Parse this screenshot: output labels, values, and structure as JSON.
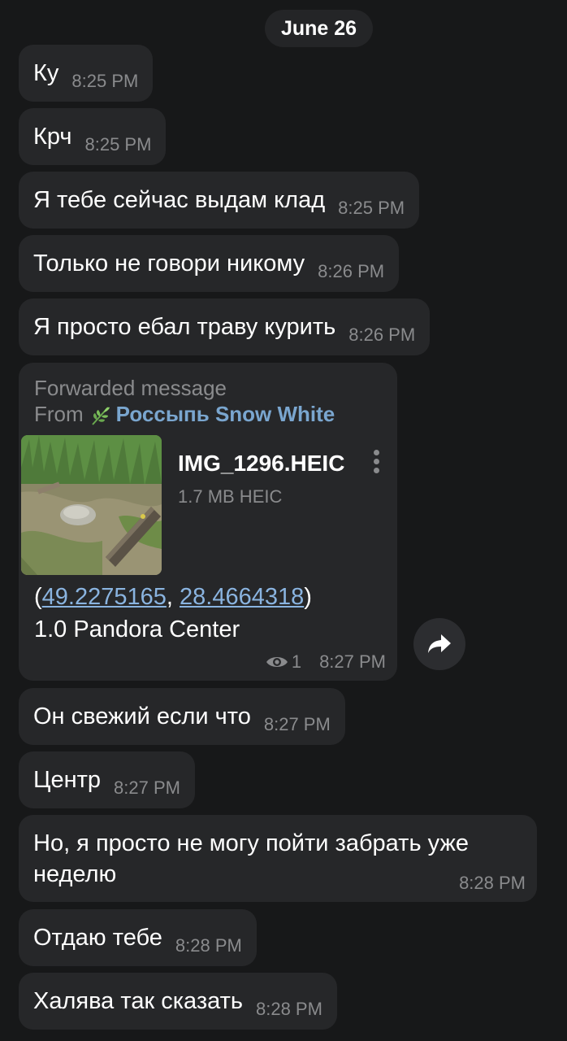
{
  "date_separator": "June 26",
  "messages_before": [
    {
      "text": "Ку",
      "time": "8:25 PM"
    },
    {
      "text": "Крч",
      "time": "8:25 PM"
    },
    {
      "text": "Я тебе сейчас выдам клад",
      "time": "8:25 PM"
    },
    {
      "text": "Только не говори никому",
      "time": "8:26 PM"
    },
    {
      "text": "Я просто ебал траву курить",
      "time": "8:26 PM"
    }
  ],
  "forwarded": {
    "label": "Forwarded message",
    "from_prefix": "From",
    "icon": "herb-icon",
    "channel": "Россыпь Snow White",
    "file_name": "IMG_1296.HEIC",
    "file_meta": "1.7 MB HEIC",
    "coord_open": "(",
    "lat": "49.2275165",
    "coord_sep": ", ",
    "lon": "28.4664318",
    "coord_close": ")",
    "location": "1.0 Pandora Center",
    "views": "1",
    "time": "8:27 PM"
  },
  "messages_after": [
    {
      "text": "Он свежий если что",
      "time": "8:27 PM"
    },
    {
      "text": "Центр",
      "time": "8:27 PM"
    },
    {
      "text": "Но, я просто не могу пойти забрать уже неделю",
      "time": "8:28 PM"
    },
    {
      "text": "Отдаю тебе",
      "time": "8:28 PM"
    },
    {
      "text": "Халява так сказать",
      "time": "8:28 PM"
    }
  ],
  "colors": {
    "background": "#171819",
    "bubble": "#262729",
    "link": "#8ab4e0",
    "channel": "#7aa6cf",
    "meta": "#8a8b8d"
  }
}
